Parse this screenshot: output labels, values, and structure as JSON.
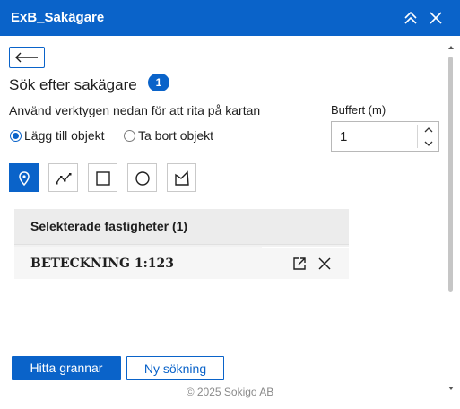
{
  "window": {
    "title": "ExB_Sakägare",
    "icons": [
      "chevrons-up-icon",
      "close-icon"
    ]
  },
  "panel": {
    "heading": "Sök efter sakägare",
    "badge": "1",
    "instruction": "Använd verktygen nedan för att rita på kartan",
    "radios": [
      {
        "label": "Lägg till objekt",
        "checked": true
      },
      {
        "label": "Ta bort objekt",
        "checked": false
      }
    ],
    "buffer": {
      "label": "Buffert (m)",
      "value": "1"
    },
    "tools": [
      {
        "name": "point-tool",
        "active": true
      },
      {
        "name": "polyline-tool",
        "active": false
      },
      {
        "name": "rectangle-tool",
        "active": false
      },
      {
        "name": "circle-tool",
        "active": false
      },
      {
        "name": "polygon-tool",
        "active": false
      }
    ]
  },
  "results": {
    "header": "Selekterade fastigheter (1)",
    "rows": [
      {
        "label": "BETECKNING 1:123"
      }
    ]
  },
  "actions": {
    "find_neighbors": "Hitta grannar",
    "new_search": "Ny sökning"
  },
  "footer": "© 2025 Sokigo AB",
  "colors": {
    "accent": "#0a63c9"
  }
}
